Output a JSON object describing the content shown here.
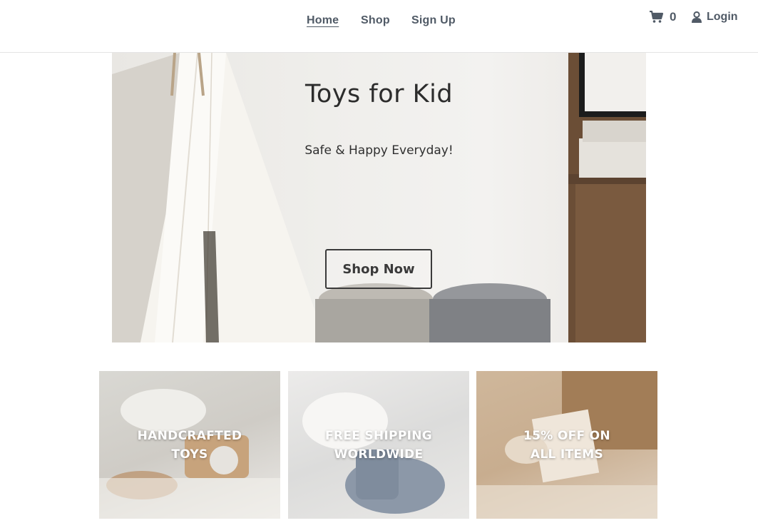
{
  "nav": {
    "items": [
      {
        "label": "Home"
      },
      {
        "label": "Shop"
      },
      {
        "label": "Sign Up"
      }
    ]
  },
  "cart": {
    "count": "0",
    "icon": "shopping-cart-icon"
  },
  "login": {
    "label": "Login",
    "icon": "user-icon"
  },
  "hero": {
    "title": "Toys for Kid",
    "subtitle": "Safe & Happy Everyday!",
    "button_label": "Shop Now"
  },
  "features": [
    {
      "line1": "HANDCRAFTED",
      "line2": "TOYS"
    },
    {
      "line1": "FREE SHIPPING",
      "line2": "WORLDWIDE"
    },
    {
      "line1": "15% OFF ON",
      "line2": "ALL ITEMS"
    }
  ],
  "colors": {
    "nav_text": "#505a66",
    "hero_text": "#2c2c2c",
    "tile_text": "#ffffff"
  }
}
